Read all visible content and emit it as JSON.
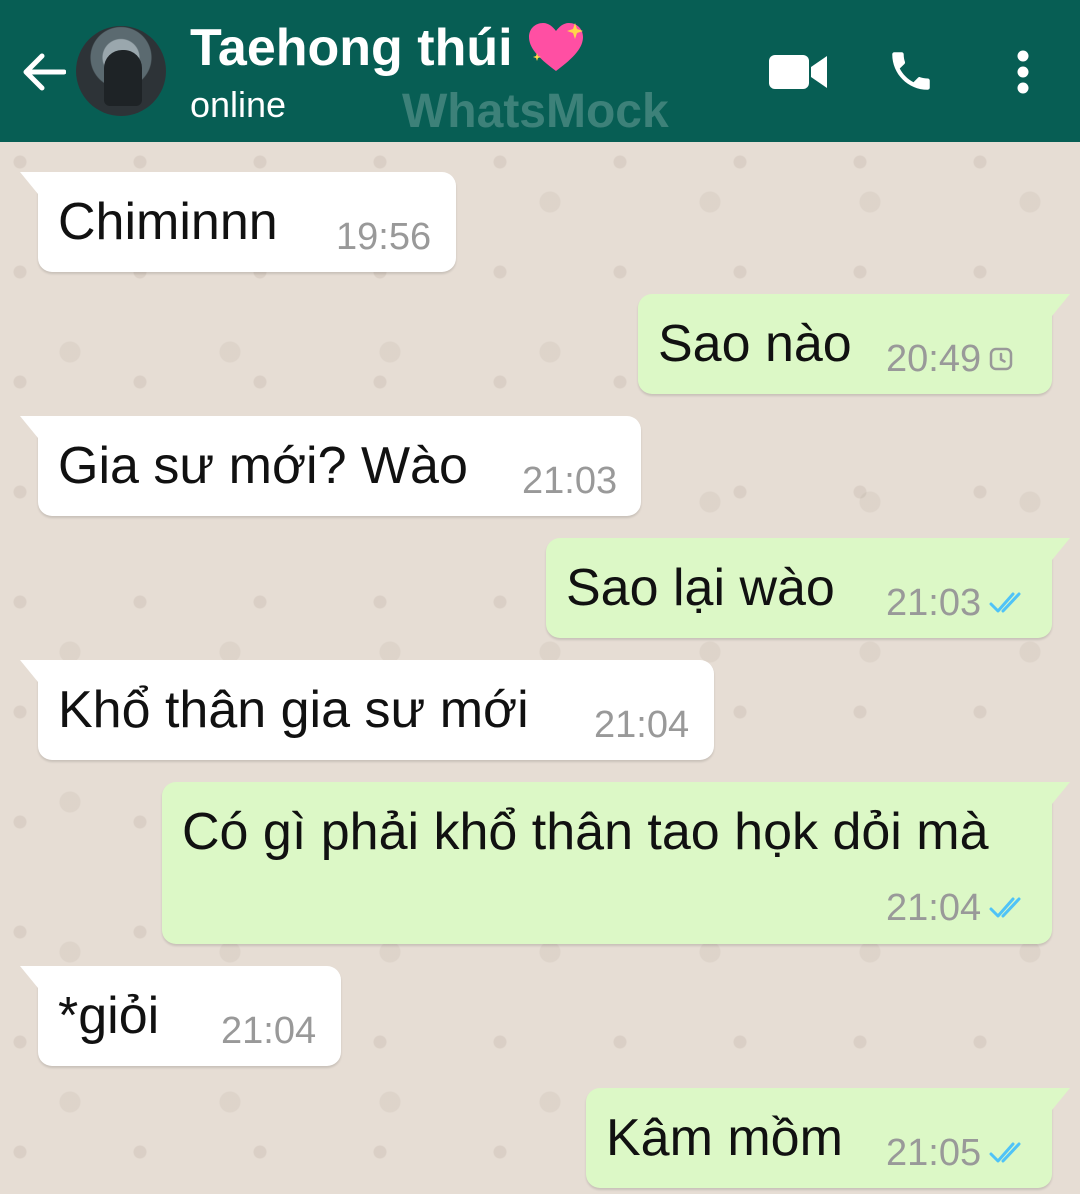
{
  "header": {
    "contact_name": "Taehong thúi",
    "status": "online",
    "watermark": "WhatsMock",
    "icons": {
      "back": "arrow-left-icon",
      "video": "video-camera-icon",
      "call": "phone-icon",
      "more": "more-vertical-icon",
      "name_emoji": "sparkling-heart-icon"
    },
    "colors": {
      "bar": "#075e54",
      "text": "#ffffff"
    }
  },
  "messages": [
    {
      "direction": "incoming",
      "text": "Chiminnn",
      "time": "19:56"
    },
    {
      "direction": "outgoing",
      "text": "Sao nào",
      "time": "20:49",
      "status": "pending-clock-icon"
    },
    {
      "direction": "incoming",
      "text": "Gia sư mới? Wào",
      "time": "21:03"
    },
    {
      "direction": "outgoing",
      "text": "Sao lại wào",
      "time": "21:03",
      "status": "read-double-check-icon"
    },
    {
      "direction": "incoming",
      "text": "Khổ thân gia sư mới",
      "time": "21:04"
    },
    {
      "direction": "outgoing",
      "text": "Có gì phải khổ thân tao họk dỏi mà",
      "time": "21:04",
      "status": "read-double-check-icon"
    },
    {
      "direction": "incoming",
      "text": "*giỏi",
      "time": "21:04"
    },
    {
      "direction": "outgoing",
      "text": "Kâm mồm",
      "time": "21:05",
      "status": "read-double-check-icon"
    }
  ],
  "colors": {
    "chat_background": "#e6ddd4",
    "incoming_bubble": "#ffffff",
    "outgoing_bubble": "#dcf8c6",
    "read_ticks": "#4fc3f7",
    "timestamp": "#999999"
  }
}
